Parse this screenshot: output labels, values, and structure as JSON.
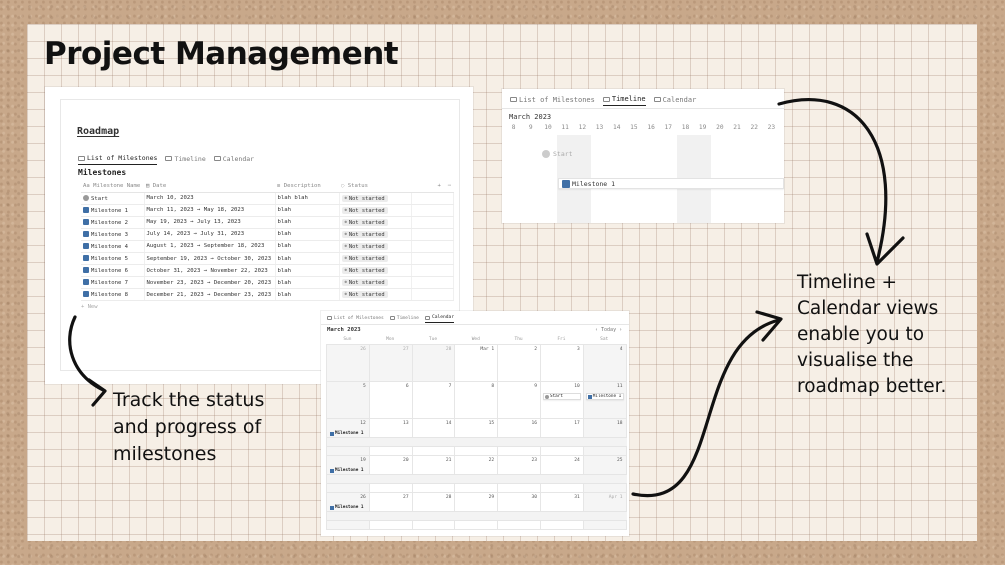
{
  "title": "Project Management",
  "captions": {
    "left": [
      "Track the status",
      "and progress of",
      "milestones"
    ],
    "right": [
      "Timeline +",
      "Calendar views",
      "enable you to",
      "visualise the",
      "roadmap better."
    ]
  },
  "view_tabs": [
    "List of Milestones",
    "Timeline",
    "Calendar"
  ],
  "roadmap": {
    "page_title": "Roadmap",
    "heading": "Milestones",
    "columns": [
      "Milestone Name",
      "Date",
      "Description",
      "Status"
    ],
    "rows": [
      {
        "icon": "start",
        "name": "Start",
        "date": "March 10, 2023",
        "desc": "blah blah",
        "status": "Not started"
      },
      {
        "icon": "1",
        "name": "Milestone 1",
        "date": "March 11, 2023 → May 18, 2023",
        "desc": "blah",
        "status": "Not started"
      },
      {
        "icon": "2",
        "name": "Milestone 2",
        "date": "May 19, 2023 → July 13, 2023",
        "desc": "blah",
        "status": "Not started"
      },
      {
        "icon": "3",
        "name": "Milestone 3",
        "date": "July 14, 2023 → July 31, 2023",
        "desc": "blah",
        "status": "Not started"
      },
      {
        "icon": "4",
        "name": "Milestone 4",
        "date": "August 1, 2023 → September 18, 2023",
        "desc": "blah",
        "status": "Not started"
      },
      {
        "icon": "5",
        "name": "Milestone 5",
        "date": "September 19, 2023 → October 30, 2023",
        "desc": "blah",
        "status": "Not started"
      },
      {
        "icon": "6",
        "name": "Milestone 6",
        "date": "October 31, 2023 → November 22, 2023",
        "desc": "blah",
        "status": "Not started"
      },
      {
        "icon": "7",
        "name": "Milestone 7",
        "date": "November 23, 2023 → December 20, 2023",
        "desc": "blah",
        "status": "Not started"
      },
      {
        "icon": "8",
        "name": "Milestone 8",
        "date": "December 21, 2023 → December 23, 2023",
        "desc": "blah",
        "status": "Not started"
      }
    ],
    "new_label": "+ New"
  },
  "timeline": {
    "month": "March 2023",
    "days": [
      "8",
      "9",
      "10",
      "11",
      "12",
      "13",
      "14",
      "15",
      "16",
      "17",
      "18",
      "19",
      "20",
      "21",
      "22",
      "23"
    ],
    "start_label": "Start",
    "milestone_label": "Milestone 1"
  },
  "calendar": {
    "month": "March 2023",
    "today_label": "Today",
    "weekdays": [
      "Sun",
      "Mon",
      "Tue",
      "Wed",
      "Thu",
      "Fri",
      "Sat"
    ],
    "weeks": [
      [
        "26",
        "27",
        "28",
        "Mar 1",
        "2",
        "3",
        "4"
      ],
      [
        "5",
        "6",
        "7",
        "8",
        "9",
        "10",
        "11"
      ],
      [
        "12",
        "13",
        "14",
        "15",
        "16",
        "17",
        "18"
      ],
      [
        "19",
        "20",
        "21",
        "22",
        "23",
        "24",
        "25"
      ],
      [
        "26",
        "27",
        "28",
        "29",
        "30",
        "31",
        "Apr 1"
      ]
    ],
    "start_label": "Start",
    "milestone_label": "Milestone 1"
  }
}
